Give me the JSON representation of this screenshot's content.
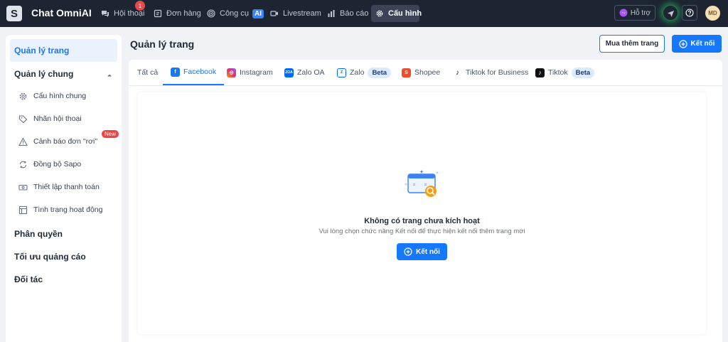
{
  "app": {
    "logo_letter": "S",
    "title": "Chat OmniAI"
  },
  "nav": {
    "items": [
      {
        "label": "Hội thoại",
        "icon": "chat-bubbles-icon",
        "badge": "1"
      },
      {
        "label": "Đơn hàng",
        "icon": "order-icon"
      },
      {
        "label": "Công cụ",
        "icon": "target-icon",
        "ai_badge": "AI"
      },
      {
        "label": "Livestream",
        "icon": "video-icon"
      },
      {
        "label": "Báo cáo",
        "icon": "bar-chart-icon"
      },
      {
        "label": "Cấu hình",
        "icon": "gear-icon",
        "active": true
      }
    ],
    "support_label": "Hỗ trợ",
    "avatar_initials": "MD"
  },
  "sidebar": {
    "active_label": "Quản lý trang",
    "general_label": "Quản lý chung",
    "sub_items": [
      {
        "label": "Cấu hình chung",
        "icon": "gear-icon"
      },
      {
        "label": "Nhãn hội thoại",
        "icon": "tag-icon"
      },
      {
        "label": "Cảnh báo đơn \"rơi\"",
        "icon": "warning-icon",
        "badge": "New"
      },
      {
        "label": "Đồng bộ Sapo",
        "icon": "sync-icon"
      },
      {
        "label": "Thiết lập thanh toán",
        "icon": "payment-icon"
      },
      {
        "label": "Tình trạng hoạt động",
        "icon": "layout-icon"
      }
    ],
    "permissions_label": "Phân quyền",
    "ads_label": "Tối ưu quảng cáo",
    "partner_label": "Đối tác"
  },
  "main": {
    "title": "Quản lý trang",
    "buy_button": "Mua thêm trang",
    "connect_button": "Kết nối",
    "tabs": [
      {
        "label": "Tất cả"
      },
      {
        "label": "Facebook",
        "active": true,
        "icon": "facebook-icon"
      },
      {
        "label": "Instagram",
        "icon": "instagram-icon"
      },
      {
        "label": "Zalo OA",
        "icon": "zalo-oa-icon",
        "icon_text": "ZOA"
      },
      {
        "label": "Zalo",
        "icon": "zalo-icon",
        "beta": "Beta"
      },
      {
        "label": "Shopee",
        "icon": "shopee-icon"
      },
      {
        "label": "Tiktok for Business",
        "icon": "tiktok-icon"
      },
      {
        "label": "Tiktok",
        "icon": "tiktok-icon",
        "beta": "Beta"
      }
    ],
    "empty": {
      "title": "Không có trang chưa kích hoạt",
      "subtitle": "Vui lòng chọn chức năng Kết nối để thực hiện kết nối thêm trang mới",
      "button": "Kết nối"
    }
  },
  "colors": {
    "primary": "#1677ff",
    "topbar": "#1d2533",
    "background": "#f0f2f5"
  }
}
